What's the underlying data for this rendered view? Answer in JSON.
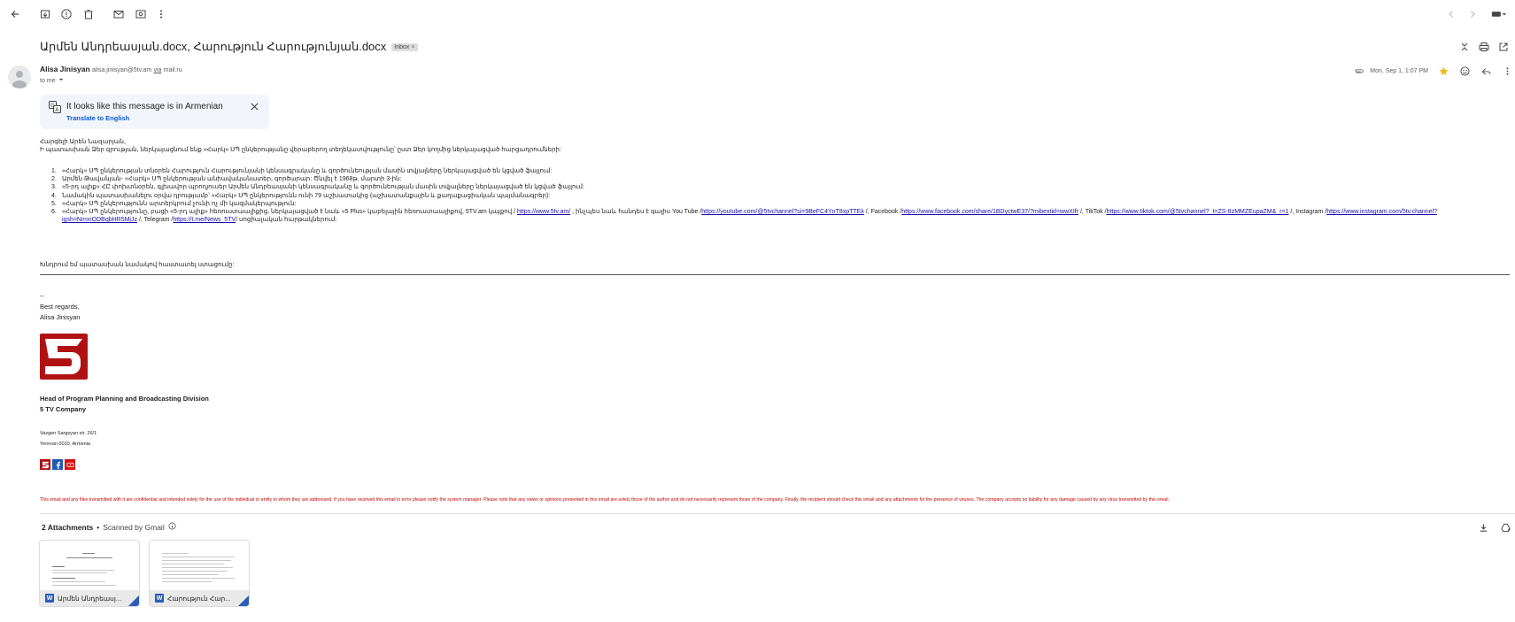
{
  "subject": {
    "title": "Արմեն Անդրեասյան.docx, Հարություն Հարությունյան.docx",
    "label": "Inbox",
    "label_close": "×"
  },
  "sender": {
    "name": "Alisa Jinisyan",
    "email": "alisa.jinisyan@5tv.am",
    "via": "via",
    "via_domain": "mail.ru",
    "to": "to me",
    "date": "Mon, Sep 1, 1:07 PM"
  },
  "translate": {
    "title": "It looks like this message is in Armenian",
    "link": "Translate to English"
  },
  "body": {
    "greeting": "Հարգելի Արեն Նազարյան,",
    "intro": "Ի պատասխան Ձեր գրության, ներկայացնում ենք «Հարկ» ՍՊ ընկերությանը վերաբերող տեղեկատվությունը՝ ըստ Ձեր կողմից ներկայացված հարցադրումների:",
    "items": [
      {
        "num": "1.",
        "text": "«Հարկ» ՍՊ ընկերության տնօրեն Հարություն Հարությունյանի կենսագրականը և գործունեության մասին տվյալները ներկայացված են կցված ֆայլում:"
      },
      {
        "num": "2.",
        "text": "Արմեն Թավանյան- «Հարկ» ՍՊ ընկերության անիավականատեր, գործարար: Ծնվել է 1968թ. մարտի 3-ին:"
      },
      {
        "num": "3.",
        "text": "«5-րդ ալիք» ՀԸ փոխտնօրեն, գլխավոր պրոդյուսեր Արմեն Անդրեասյանի կենսագրականը և գործունեության մասին տվյալները ներկայացված են կցված ֆայլում:"
      },
      {
        "num": "4.",
        "text": "Նամակին պատասխանելու օրվա դրությամբ՝ «Հարկ» ՍՊ ընկերությունն ունի 79 աշխատակից (աշխատանքային և քաղաքացիական պայմանագրեր):"
      },
      {
        "num": "5.",
        "text": "«Հարկ» ՍՊ ընկերությունն արտերկրում չունի ոչ մի կազմակերպություն:"
      }
    ],
    "item6": {
      "num": "6.",
      "part1": "«Հարկ» ՍՊ ընկերությունը, բացի «5-րդ ալիք» հեռուստաալիքից, ներկայացված է նաև «5 Plus» կաբելային հեռուստաալիքով, 5TV.am կայքով / ",
      "link1": "https://www.5tv.am/",
      "part2": " , ինչպես նաև հանդես է գալիս You Tube /",
      "link2": "https://youtube.com/@5tvchannel?si=9BeFC4YnT8xpTTEk",
      "part3": " /, Facebook /",
      "link3": "https://www.facebook.com/share/1BDyctwE37/?mibextid=wwXIfr",
      "part4": " /, TikTok /",
      "link4": "https://www.tiktok.com/@5tvchannel?_t=ZS-8zMMZEupaZM&_r=1",
      "part5": " /, Instagram /",
      "link5": "https://www.instagram.com/5tv.channel?igsh=NmxrODBqbHR5MjJz",
      "part6": " /, Telegram /",
      "link6": "https://t.me/News_5TV",
      "part7": "/  սոցիալական հարթակներում:"
    },
    "closing": "Խնդրում եմ պատասխան նամակով հաստատել ստացումը:"
  },
  "signature": {
    "dashes": "--",
    "regards": "Best regards,",
    "name": "Alisa Jinisyan",
    "logo_text": "5",
    "position": "Head of Program Planning and Broadcasting Division",
    "company": "5 TV Company",
    "address1": "Vazgen Sargsyan str. 26/1",
    "address2": "Yerevan 0010, Armenia"
  },
  "disclaimer": "This email and any files transmitted with it are confidential and intended solely for the use of the individual or entity to whom they are addressed. If you have received this email in error please notify the system manager. Please note that any views or opinions presented in this email are solely those of the author and do not necessarily represent those of the company. Finally, the recipient should check this email and any attachments for the presence of viruses. The company accepts no liability for any damage caused by any virus transmitted by this email.",
  "attachments": {
    "count_label": "2 Attachments",
    "dot": "•",
    "scanned": "Scanned by Gmail",
    "files": [
      {
        "name": "Արմեն Անդրեասյ...",
        "badge": "W"
      },
      {
        "name": "Հարություն Հար...",
        "badge": "W"
      }
    ]
  },
  "colors": {
    "link": "#1a0dab",
    "accent": "#0b57d0",
    "brand_red": "#b01214",
    "disclaimer": "#c00000",
    "star": "#f4b400"
  }
}
